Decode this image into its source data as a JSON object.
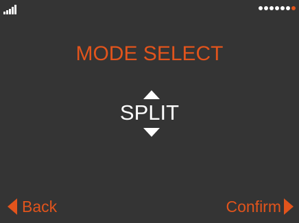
{
  "status": {
    "signal_icon": "signal-strength-icon",
    "signal_bars": 5,
    "page_indicator": {
      "count": 7,
      "active_index": 6,
      "dot_color": "#ffffff",
      "active_color": "#e2541c"
    }
  },
  "screen": {
    "title": "MODE SELECT",
    "value": "SPLIT",
    "up_icon": "triangle-up-icon",
    "down_icon": "triangle-down-icon"
  },
  "nav": {
    "back_label": "Back",
    "back_icon": "triangle-left-icon",
    "confirm_label": "Confirm",
    "confirm_icon": "triangle-right-icon"
  },
  "colors": {
    "background": "#343434",
    "accent": "#e2541c",
    "text": "#ffffff"
  }
}
